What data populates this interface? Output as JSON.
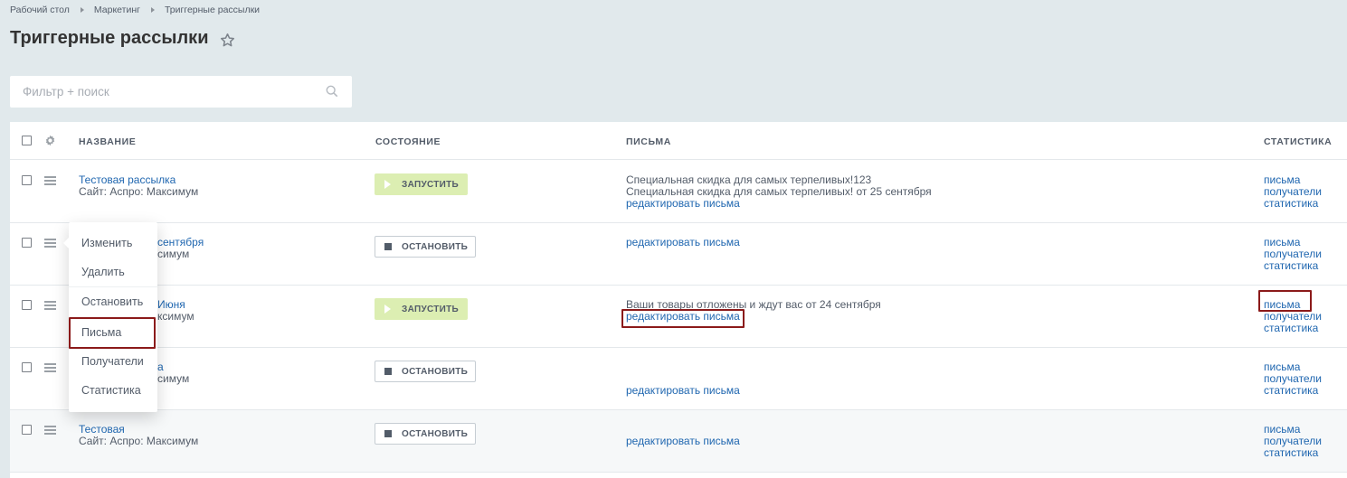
{
  "breadcrumb": [
    "Рабочий стол",
    "Маркетинг",
    "Триггерные рассылки"
  ],
  "page_title": "Триггерные рассылки",
  "filter": {
    "placeholder": "Фильтр + поиск"
  },
  "columns": {
    "name": "НАЗВАНИЕ",
    "state": "СОСТОЯНИЕ",
    "letters": "ПИСЬМА",
    "stats": "СТАТИСТИКА"
  },
  "buttons": {
    "start": "ЗАПУСТИТЬ",
    "stop": "ОСТАНОВИТЬ"
  },
  "edit_letters": "редактировать письма",
  "stats_links": [
    "письма",
    "получатели",
    "статистика"
  ],
  "rows": [
    {
      "name": "Тестовая рассылка",
      "site": "Сайт: Аспро: Максимум",
      "state": "start",
      "letters": [
        "Специальная скидка для самых терпеливых!123",
        "Специальная скидка для самых терпеливых! от 25 сентября"
      ]
    },
    {
      "name": "сентября",
      "site": "симум",
      "state": "stop",
      "letters": []
    },
    {
      "name": "Июня",
      "site": "ксимум",
      "state": "start",
      "letters": [
        "Ваши товары отложены и ждут вас от 24 сентября"
      ]
    },
    {
      "name": "а",
      "site": "симум",
      "state": "stop",
      "letters": []
    },
    {
      "name": "Тестовая",
      "site": "Сайт: Аспро: Максимум",
      "state": "stop",
      "letters": []
    }
  ],
  "context_menu": [
    "Изменить",
    "Удалить",
    "Остановить",
    "Письма",
    "Получатели",
    "Статистика"
  ],
  "colors": {
    "link": "#2067b0",
    "highlight": "#8b1a1a",
    "start_btn": "#dceeb2",
    "background": "#e1e9ec"
  }
}
